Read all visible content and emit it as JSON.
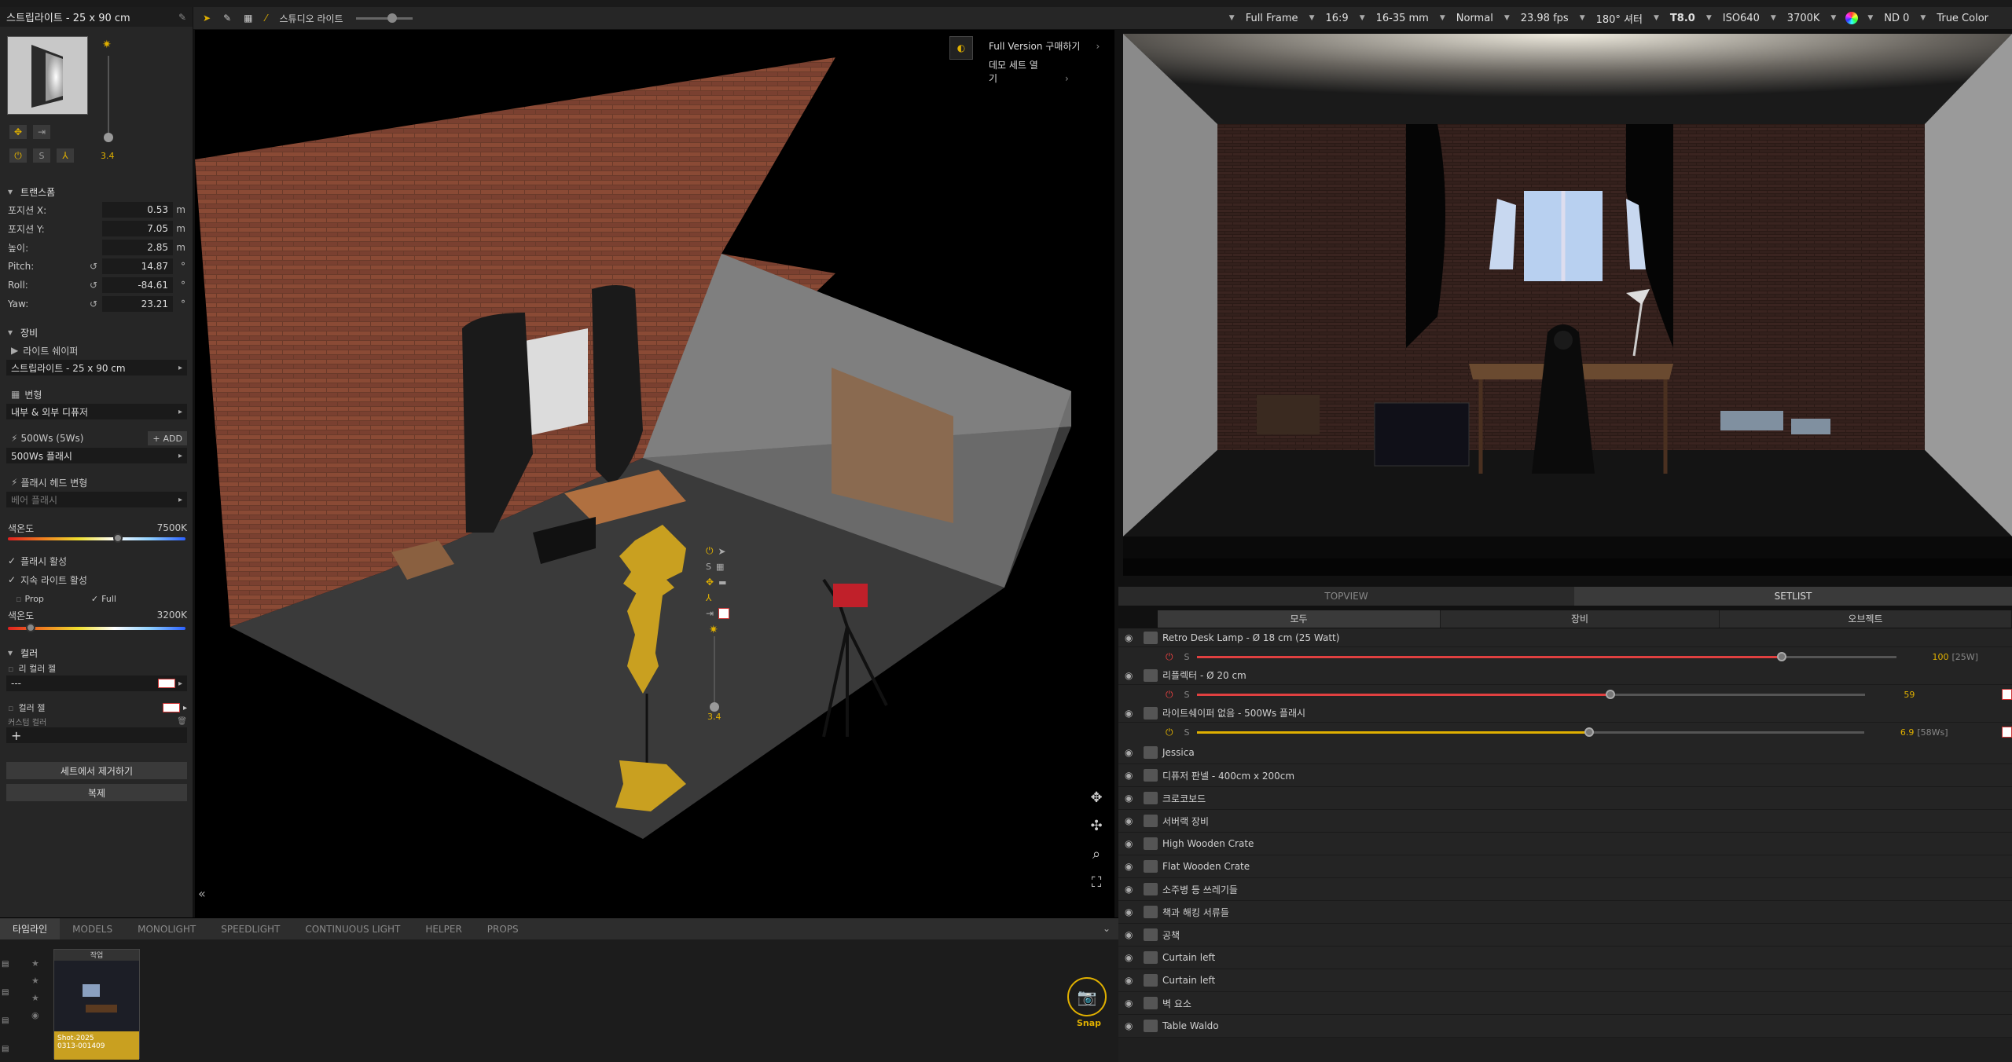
{
  "left_panel": {
    "title": "스트립라이트 - 25 x 90 cm",
    "level_value": "3.4",
    "transform": {
      "section": "트랜스폼",
      "rows": [
        {
          "label": "포지션 X:",
          "value": "0.53",
          "unit": "m"
        },
        {
          "label": "포지션 Y:",
          "value": "7.05",
          "unit": "m"
        },
        {
          "label": "높이:",
          "value": "2.85",
          "unit": "m"
        },
        {
          "label": "Pitch:",
          "value": "14.87",
          "unit": "°"
        },
        {
          "label": "Roll:",
          "value": "-84.61",
          "unit": "°"
        },
        {
          "label": "Yaw:",
          "value": "23.21",
          "unit": "°"
        }
      ]
    },
    "equipment": {
      "section": "장비",
      "light_shaper_label": "라이트 쉐이퍼",
      "light_shaper_value": "스트립라이트 - 25 x 90 cm",
      "variant_label": "변형",
      "variant_value": "내부 & 외부 디퓨저",
      "power_label": "500Ws (5Ws)",
      "add_label": "ADD",
      "power_value": "500Ws 플래시",
      "flash_head_label": "플래시 헤드 변형",
      "flash_head_value": "베어 플래시",
      "color_temp_label": "색온도",
      "color_temp_value": "7500K",
      "color_temp_pos": 0.62,
      "flash_active": "플래시 활성",
      "continuous_active": "지속 라이트 활성",
      "prop_label": "Prop",
      "full_label": "Full",
      "color_temp2_label": "색온도",
      "color_temp2_value": "3200K",
      "color_temp2_pos": 0.13
    },
    "color": {
      "section": "컬러",
      "lee_label": "리 컬러 젤",
      "lee_value": "---",
      "gel_label": "컬러 젤",
      "custom_label": "커스텀 컬러"
    },
    "remove_button": "세트에서 제거하기",
    "duplicate_button": "복제"
  },
  "toolbar": {
    "studio_light_label": "스튜디오 라이트"
  },
  "viewport": {
    "full_version": "Full Version 구매하기",
    "demo_set": "데모 세트 열기",
    "light_level": "3.4"
  },
  "camera_bar": {
    "items": [
      "Full Frame",
      "16:9",
      "16-35 mm",
      "Normal",
      "23.98 fps",
      "180° 셔터",
      "T8.0",
      "ISO640",
      "3700K",
      "",
      "ND 0",
      "True Color"
    ]
  },
  "right_tabs": {
    "topview": "TOPVIEW",
    "setlist": "SETLIST"
  },
  "set_tabs": [
    "모두",
    "장비",
    "오브젝트"
  ],
  "setlist": {
    "lights": [
      {
        "name": "Retro Desk Lamp - Ø 18 cm (25 Watt)",
        "value": "100",
        "extra": "[25W]",
        "pos": 0.835,
        "color": "#e04040",
        "power": "red"
      },
      {
        "name": "리플렉터 - Ø 20 cm",
        "value": "59",
        "extra": "",
        "pos": 0.59,
        "color": "#e04040",
        "power": "red"
      },
      {
        "name": "라이트쉐이퍼 없음 - 500Ws 플래시",
        "value": "6.9",
        "extra": "[58Ws]",
        "pos": 0.56,
        "color": "#e0b000",
        "power": "yellow"
      }
    ],
    "items": [
      "Jessica",
      "디퓨저 판넬 - 400cm x 200cm",
      "크로코보드",
      "서버랙 장비",
      "High Wooden Crate",
      "Flat Wooden Crate",
      "소주병 등 쓰레기들",
      "책과 해킹 서류들",
      "공책",
      "Curtain left",
      "Curtain left",
      "벽 요소",
      "Table Waldo"
    ]
  },
  "bottom_tabs": [
    "타임라인",
    "MODELS",
    "MONOLIGHT",
    "SPEEDLIGHT",
    "CONTINUOUS LIGHT",
    "HELPER",
    "PROPS"
  ],
  "timeline": {
    "shot_title": "작업",
    "shot_name": "Shot-2025",
    "shot_id": "0313-001409",
    "snap_label": "Snap"
  },
  "colors": {
    "accent": "#e0b000",
    "power_red": "#e04040",
    "panel": "#262626"
  }
}
